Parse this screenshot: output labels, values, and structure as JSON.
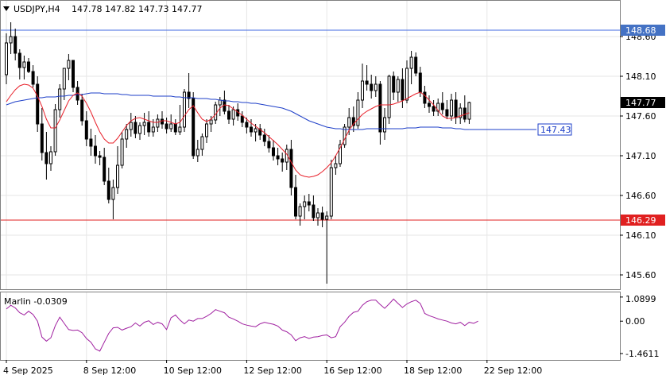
{
  "header": {
    "symbol": "USDJPY,H4",
    "ohlc": "147.78 147.82 147.73 147.77"
  },
  "indicator": {
    "label": "Marlin -0.0309",
    "ticks": [
      "1.0899",
      "0.00",
      "-1.4611"
    ],
    "tick_values": [
      1.0899,
      0.0,
      -1.4611
    ]
  },
  "colors": {
    "background": "#ffffff",
    "plot_bg": "#ffffff",
    "grid": "#e6e6e6",
    "border": "#808080",
    "candle": "#000000",
    "ma_fast": "#e8202a",
    "ma_slow": "#1e3fc8",
    "resistance_line": "#4169e1",
    "support_line": "#e02020",
    "osc": "#a020a0",
    "label_resistance_bg": "#4472c4",
    "label_support_bg": "#e02020",
    "label_current_bg": "#000000",
    "label_ma_border": "#1e3fc8"
  },
  "chart_data": {
    "type": "candlestick",
    "price_axis_ticks": [
      "148.60",
      "148.10",
      "147.60",
      "147.10",
      "146.60",
      "146.10",
      "145.60"
    ],
    "price_tick_values": [
      148.6,
      148.1,
      147.6,
      147.1,
      146.6,
      146.1,
      145.6
    ],
    "ylim": [
      145.42,
      149.05
    ],
    "x_labels": [
      "4 Sep 2025",
      "8 Sep 12:00",
      "10 Sep 12:00",
      "12 Sep 12:00",
      "16 Sep 12:00",
      "18 Sep 12:00",
      "22 Sep 12:00"
    ],
    "x_label_bars": [
      0,
      18,
      36,
      54,
      72,
      90,
      108
    ],
    "levels": {
      "resistance": "148.68",
      "support": "146.29",
      "current": "147.77",
      "ma": "147.43"
    },
    "level_values": {
      "resistance": 148.68,
      "support": 146.29,
      "current": 147.77,
      "ma": 147.43
    },
    "candles": [
      [
        148.12,
        148.64,
        148.0,
        148.52
      ],
      [
        148.52,
        148.78,
        148.38,
        148.6
      ],
      [
        148.6,
        148.7,
        148.3,
        148.39
      ],
      [
        148.39,
        148.44,
        148.06,
        148.21
      ],
      [
        148.21,
        148.36,
        148.06,
        148.28
      ],
      [
        148.28,
        148.33,
        148.14,
        148.16
      ],
      [
        148.16,
        148.24,
        147.96,
        148.0
      ],
      [
        148.0,
        148.1,
        147.4,
        147.5
      ],
      [
        147.5,
        147.7,
        147.04,
        147.14
      ],
      [
        147.14,
        147.4,
        146.8,
        147.0
      ],
      [
        147.0,
        147.22,
        146.91,
        147.15
      ],
      [
        147.15,
        147.75,
        147.1,
        147.68
      ],
      [
        147.68,
        148.0,
        147.58,
        147.94
      ],
      [
        147.94,
        148.16,
        147.8,
        148.2
      ],
      [
        148.2,
        148.38,
        148.05,
        148.3
      ],
      [
        148.3,
        148.26,
        147.9,
        147.96
      ],
      [
        147.96,
        148.04,
        147.74,
        147.8
      ],
      [
        147.8,
        147.88,
        147.48,
        147.54
      ],
      [
        147.54,
        147.66,
        147.22,
        147.31
      ],
      [
        147.31,
        147.44,
        147.1,
        147.22
      ],
      [
        147.22,
        147.36,
        147.0,
        147.1
      ],
      [
        147.1,
        147.16,
        146.98,
        147.08
      ],
      [
        147.08,
        147.2,
        146.73,
        146.78
      ],
      [
        146.78,
        146.95,
        146.5,
        146.55
      ],
      [
        146.55,
        146.8,
        146.3,
        146.7
      ],
      [
        146.7,
        147.22,
        146.62,
        146.98
      ],
      [
        146.98,
        147.4,
        146.94,
        147.31
      ],
      [
        147.31,
        147.5,
        147.2,
        147.43
      ],
      [
        147.43,
        147.64,
        147.34,
        147.52
      ],
      [
        147.52,
        147.6,
        147.32,
        147.38
      ],
      [
        147.38,
        147.52,
        147.3,
        147.48
      ],
      [
        147.48,
        147.64,
        147.36,
        147.52
      ],
      [
        147.52,
        147.66,
        147.34,
        147.4
      ],
      [
        147.4,
        147.56,
        147.34,
        147.46
      ],
      [
        147.46,
        147.62,
        147.4,
        147.56
      ],
      [
        147.56,
        147.66,
        147.44,
        147.5
      ],
      [
        147.5,
        147.58,
        147.38,
        147.44
      ],
      [
        147.44,
        147.62,
        147.4,
        147.5
      ],
      [
        147.5,
        147.56,
        147.36,
        147.4
      ],
      [
        147.4,
        147.74,
        147.36,
        147.46
      ],
      [
        147.46,
        147.94,
        147.4,
        147.9
      ],
      [
        147.9,
        148.14,
        147.7,
        147.82
      ],
      [
        147.82,
        147.9,
        147.06,
        147.1
      ],
      [
        147.1,
        147.3,
        147.02,
        147.18
      ],
      [
        147.18,
        147.38,
        147.1,
        147.34
      ],
      [
        147.34,
        147.56,
        147.26,
        147.5
      ],
      [
        147.5,
        147.6,
        147.4,
        147.55
      ],
      [
        147.55,
        147.78,
        147.5,
        147.74
      ],
      [
        147.74,
        147.84,
        147.6,
        147.8
      ],
      [
        147.8,
        147.92,
        147.62,
        147.66
      ],
      [
        147.66,
        147.74,
        147.5,
        147.56
      ],
      [
        147.56,
        147.72,
        147.48,
        147.68
      ],
      [
        147.68,
        147.76,
        147.54,
        147.6
      ],
      [
        147.6,
        147.66,
        147.46,
        147.52
      ],
      [
        147.52,
        147.58,
        147.38,
        147.46
      ],
      [
        147.46,
        147.56,
        147.34,
        147.4
      ],
      [
        147.4,
        147.5,
        147.28,
        147.44
      ],
      [
        147.44,
        147.5,
        147.3,
        147.36
      ],
      [
        147.36,
        147.44,
        147.22,
        147.28
      ],
      [
        147.28,
        147.36,
        147.14,
        147.2
      ],
      [
        147.2,
        147.3,
        147.04,
        147.1
      ],
      [
        147.1,
        147.2,
        146.98,
        147.06
      ],
      [
        147.06,
        147.14,
        146.9,
        147.02
      ],
      [
        147.02,
        147.24,
        146.92,
        147.18
      ],
      [
        147.18,
        147.3,
        146.6,
        146.7
      ],
      [
        146.7,
        146.86,
        146.3,
        146.34
      ],
      [
        146.34,
        146.5,
        146.22,
        146.46
      ],
      [
        146.46,
        146.6,
        146.3,
        146.52
      ],
      [
        146.52,
        146.62,
        146.4,
        146.48
      ],
      [
        146.48,
        146.6,
        146.28,
        146.32
      ],
      [
        146.32,
        146.44,
        146.22,
        146.38
      ],
      [
        146.38,
        146.46,
        146.2,
        146.3
      ],
      [
        146.3,
        146.4,
        145.49,
        146.34
      ],
      [
        146.34,
        147.05,
        146.3,
        146.95
      ],
      [
        146.95,
        147.1,
        146.86,
        147.0
      ],
      [
        147.0,
        147.3,
        146.96,
        147.24
      ],
      [
        147.24,
        147.5,
        147.2,
        147.46
      ],
      [
        147.46,
        147.7,
        147.36,
        147.58
      ],
      [
        147.58,
        147.72,
        147.4,
        147.48
      ],
      [
        147.48,
        147.9,
        147.44,
        147.8
      ],
      [
        147.8,
        148.26,
        147.7,
        148.04
      ],
      [
        148.04,
        148.24,
        147.92,
        148.0
      ],
      [
        148.0,
        148.12,
        147.82,
        147.92
      ],
      [
        147.92,
        148.1,
        147.84,
        148.0
      ],
      [
        148.0,
        148.04,
        147.24,
        147.4
      ],
      [
        147.4,
        147.7,
        147.3,
        147.58
      ],
      [
        147.58,
        148.12,
        147.5,
        148.1
      ],
      [
        148.1,
        148.16,
        147.8,
        147.9
      ],
      [
        147.9,
        148.1,
        147.78,
        148.06
      ],
      [
        148.06,
        148.2,
        147.7,
        147.8
      ],
      [
        147.8,
        148.3,
        147.76,
        148.2
      ],
      [
        148.2,
        148.42,
        148.0,
        148.34
      ],
      [
        148.34,
        148.4,
        148.1,
        148.14
      ],
      [
        148.14,
        148.22,
        147.84,
        147.9
      ],
      [
        147.9,
        147.98,
        147.7,
        147.76
      ],
      [
        147.76,
        147.86,
        147.64,
        147.72
      ],
      [
        147.72,
        147.8,
        147.6,
        147.66
      ],
      [
        147.66,
        147.82,
        147.6,
        147.76
      ],
      [
        147.76,
        147.9,
        147.62,
        147.68
      ],
      [
        147.68,
        147.8,
        147.56,
        147.6
      ],
      [
        147.6,
        147.88,
        147.54,
        147.8
      ],
      [
        147.8,
        147.9,
        147.5,
        147.58
      ],
      [
        147.58,
        147.76,
        147.5,
        147.7
      ],
      [
        147.7,
        147.86,
        147.52,
        147.56
      ],
      [
        147.56,
        147.78,
        147.5,
        147.77
      ]
    ],
    "ma_fast": [
      147.78,
      147.86,
      147.93,
      147.98,
      148.0,
      147.99,
      147.95,
      147.85,
      147.72,
      147.56,
      147.45,
      147.45,
      147.55,
      147.67,
      147.79,
      147.86,
      147.89,
      147.85,
      147.76,
      147.65,
      147.52,
      147.4,
      147.31,
      147.26,
      147.26,
      147.32,
      147.4,
      147.48,
      147.54,
      147.57,
      147.58,
      147.56,
      147.54,
      147.52,
      147.52,
      147.54,
      147.54,
      147.52,
      147.5,
      147.52,
      147.6,
      147.68,
      147.73,
      147.64,
      147.56,
      147.53,
      147.56,
      147.62,
      147.7,
      147.74,
      147.73,
      147.69,
      147.65,
      147.61,
      147.56,
      147.51,
      147.47,
      147.43,
      147.39,
      147.34,
      147.29,
      147.24,
      147.18,
      147.12,
      147.02,
      146.92,
      146.86,
      146.84,
      146.83,
      146.84,
      146.86,
      146.9,
      146.95,
      147.01,
      147.1,
      147.2,
      147.31,
      147.42,
      147.5,
      147.56,
      147.62,
      147.66,
      147.69,
      147.72,
      147.74,
      147.74,
      147.74,
      147.75,
      147.77,
      147.79,
      147.82,
      147.85,
      147.88,
      147.9,
      147.86,
      147.8,
      147.74,
      147.67,
      147.6,
      147.57,
      147.57,
      147.58,
      147.6,
      147.62,
      147.64
    ],
    "ma_slow": [
      147.74,
      147.76,
      147.78,
      147.79,
      147.8,
      147.81,
      147.82,
      147.83,
      147.83,
      147.84,
      147.84,
      147.84,
      147.85,
      147.85,
      147.86,
      147.86,
      147.87,
      147.87,
      147.88,
      147.89,
      147.89,
      147.89,
      147.88,
      147.88,
      147.88,
      147.88,
      147.87,
      147.87,
      147.86,
      147.86,
      147.86,
      147.86,
      147.86,
      147.85,
      147.85,
      147.85,
      147.85,
      147.85,
      147.84,
      147.84,
      147.83,
      147.83,
      147.83,
      147.82,
      147.82,
      147.82,
      147.81,
      147.81,
      147.8,
      147.79,
      147.79,
      147.78,
      147.78,
      147.77,
      147.77,
      147.76,
      147.76,
      147.75,
      147.74,
      147.73,
      147.72,
      147.71,
      147.7,
      147.68,
      147.66,
      147.63,
      147.6,
      147.57,
      147.54,
      147.52,
      147.5,
      147.48,
      147.46,
      147.45,
      147.44,
      147.44,
      147.43,
      147.43,
      147.43,
      147.43,
      147.43,
      147.44,
      147.44,
      147.44,
      147.44,
      147.44,
      147.44,
      147.44,
      147.44,
      147.44,
      147.45,
      147.45,
      147.45,
      147.46,
      147.46,
      147.46,
      147.46,
      147.46,
      147.45,
      147.45,
      147.45,
      147.44,
      147.44,
      147.43,
      147.43
    ],
    "oscillator": {
      "name": "Marlin",
      "ylim": [
        -1.75,
        1.3
      ],
      "values": [
        0.55,
        0.72,
        0.6,
        0.38,
        0.28,
        0.45,
        0.3,
        0.0,
        -0.72,
        -0.9,
        -0.75,
        -0.2,
        0.18,
        -0.1,
        -0.38,
        -0.42,
        -0.4,
        -0.52,
        -0.78,
        -0.95,
        -1.25,
        -1.35,
        -0.95,
        -0.55,
        -0.3,
        -0.28,
        -0.4,
        -0.32,
        -0.25,
        -0.08,
        -0.22,
        -0.05,
        0.02,
        -0.15,
        -0.05,
        -0.12,
        -0.38,
        0.15,
        0.28,
        0.05,
        -0.12,
        0.05,
        0.0,
        0.12,
        0.12,
        0.22,
        0.35,
        0.52,
        0.45,
        0.38,
        0.18,
        0.1,
        0.0,
        -0.12,
        -0.18,
        -0.22,
        -0.25,
        -0.12,
        -0.05,
        -0.1,
        -0.14,
        -0.22,
        -0.4,
        -0.48,
        -0.62,
        -0.88,
        -0.75,
        -0.7,
        -0.78,
        -0.72,
        -0.7,
        -0.65,
        -0.62,
        -0.75,
        -0.7,
        -0.25,
        -0.05,
        0.22,
        0.4,
        0.45,
        0.72,
        0.88,
        0.95,
        0.95,
        0.75,
        0.58,
        0.78,
        1.0,
        0.8,
        0.62,
        0.78,
        0.88,
        0.95,
        0.8,
        0.35,
        0.25,
        0.18,
        0.1,
        0.05,
        0.0,
        -0.08,
        -0.12,
        -0.05,
        -0.2,
        -0.05,
        -0.1,
        0.0
      ]
    }
  }
}
